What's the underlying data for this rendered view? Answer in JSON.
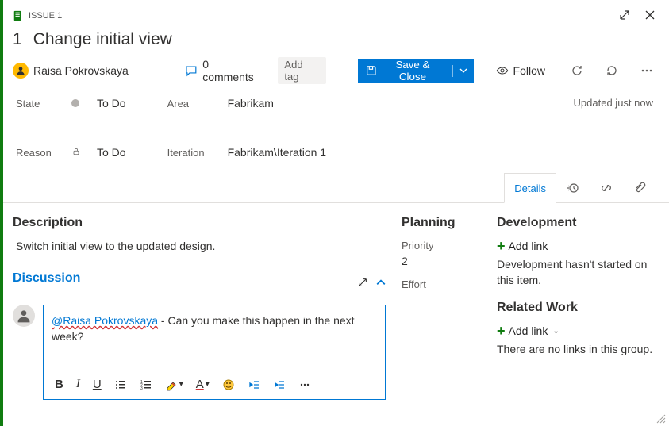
{
  "issueBadge": "ISSUE 1",
  "titleId": "1",
  "titleText": "Change initial view",
  "assignee": "Raisa Pokrovskaya",
  "comments": {
    "count": "0 comments"
  },
  "addTagLabel": "Add tag",
  "saveLabel": "Save & Close",
  "followLabel": "Follow",
  "fields": {
    "stateLabel": "State",
    "stateValue": "To Do",
    "reasonLabel": "Reason",
    "reasonValue": "To Do",
    "areaLabel": "Area",
    "areaValue": "Fabrikam",
    "iterationLabel": "Iteration",
    "iterationValue": "Fabrikam\\Iteration 1"
  },
  "updatedText": "Updated just now",
  "tabs": {
    "details": "Details"
  },
  "description": {
    "heading": "Description",
    "text": "Switch initial view to the updated design."
  },
  "discussion": {
    "heading": "Discussion",
    "mentionText": "@Raisa Pokrovskaya",
    "commentBody": " - Can you make this happen in the next week?"
  },
  "planning": {
    "heading": "Planning",
    "priorityLabel": "Priority",
    "priorityValue": "2",
    "effortLabel": "Effort"
  },
  "development": {
    "heading": "Development",
    "addLink": "Add link",
    "helper": "Development hasn't started on this item."
  },
  "related": {
    "heading": "Related Work",
    "addLink": "Add link",
    "helper": "There are no links in this group."
  }
}
